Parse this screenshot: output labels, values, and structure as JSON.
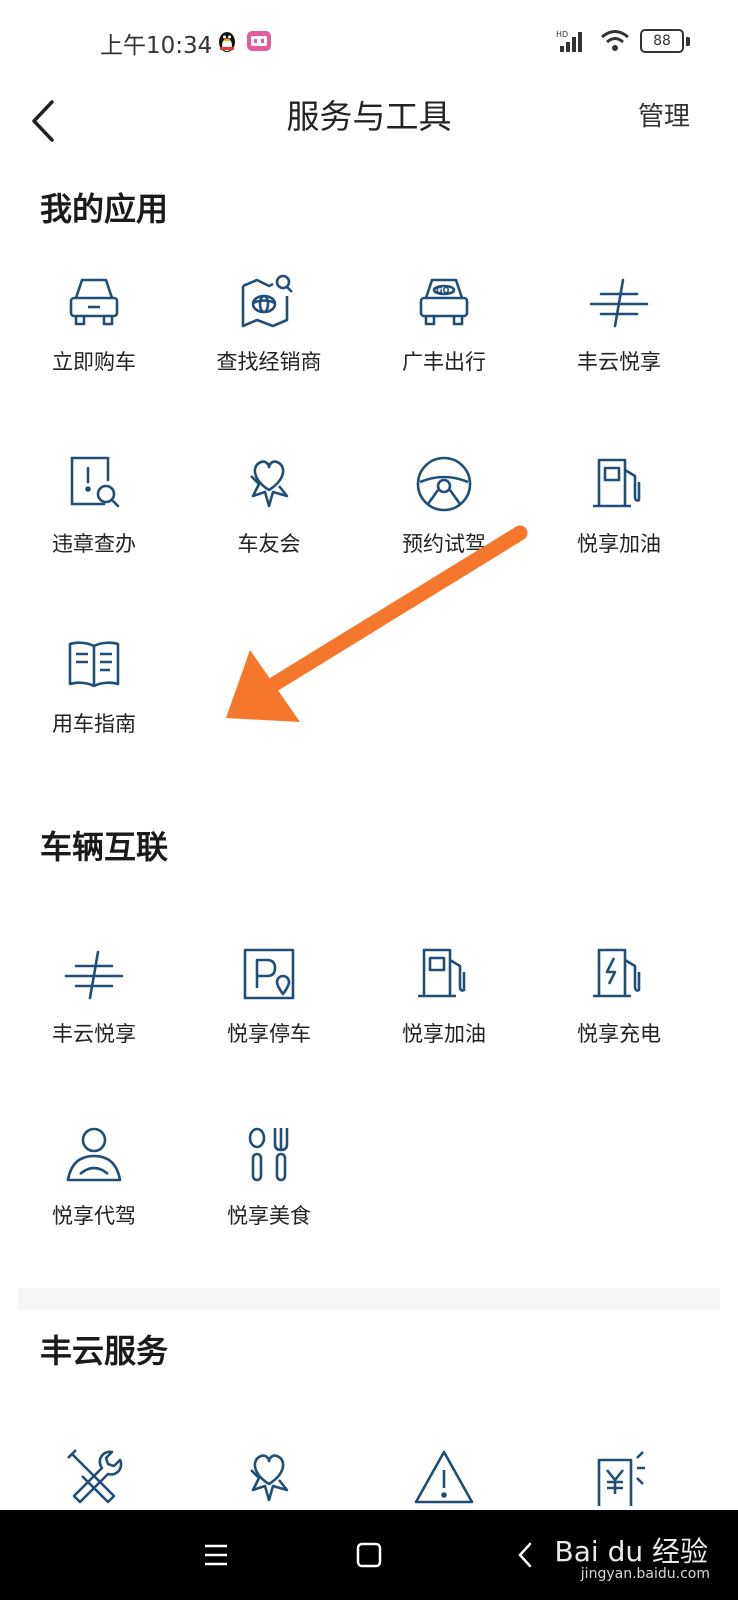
{
  "status_bar": {
    "time": "上午10:34",
    "network": "HD",
    "battery": "88"
  },
  "header": {
    "title": "服务与工具",
    "manage_label": "管理"
  },
  "sections": {
    "my_apps": {
      "title": "我的应用",
      "items": [
        {
          "label": "立即购车",
          "icon": "car-front-icon"
        },
        {
          "label": "查找经销商",
          "icon": "map-dealer-icon"
        },
        {
          "label": "广丰出行",
          "icon": "car-go-icon"
        },
        {
          "label": "丰云悦享",
          "icon": "fengyun-logo-icon"
        },
        {
          "label": "违章查办",
          "icon": "violation-search-icon"
        },
        {
          "label": "车友会",
          "icon": "heart-star-icon"
        },
        {
          "label": "预约试驾",
          "icon": "steering-wheel-icon"
        },
        {
          "label": "悦享加油",
          "icon": "fuel-pump-icon"
        },
        {
          "label": "用车指南",
          "icon": "guide-book-icon"
        }
      ]
    },
    "connected": {
      "title": "车辆互联",
      "items": [
        {
          "label": "丰云悦享",
          "icon": "fengyun-logo-icon"
        },
        {
          "label": "悦享停车",
          "icon": "parking-icon"
        },
        {
          "label": "悦享加油",
          "icon": "fuel-pump-icon"
        },
        {
          "label": "悦享充电",
          "icon": "charging-icon"
        },
        {
          "label": "悦享代驾",
          "icon": "driver-icon"
        },
        {
          "label": "悦享美食",
          "icon": "dining-icon"
        }
      ]
    },
    "fengyun": {
      "title": "丰云服务",
      "items": [
        {
          "icon": "repair-tools-icon"
        },
        {
          "icon": "heart-star-icon"
        },
        {
          "icon": "warning-triangle-icon"
        },
        {
          "icon": "yen-card-icon"
        }
      ]
    }
  },
  "watermark": {
    "main": "Bai du 经验",
    "sub": "jingyan.baidu.com"
  },
  "colors": {
    "icon": "#1f4e79",
    "arrow": "#f5772b",
    "bg": "#ffffff",
    "nav_bg": "#000000"
  }
}
